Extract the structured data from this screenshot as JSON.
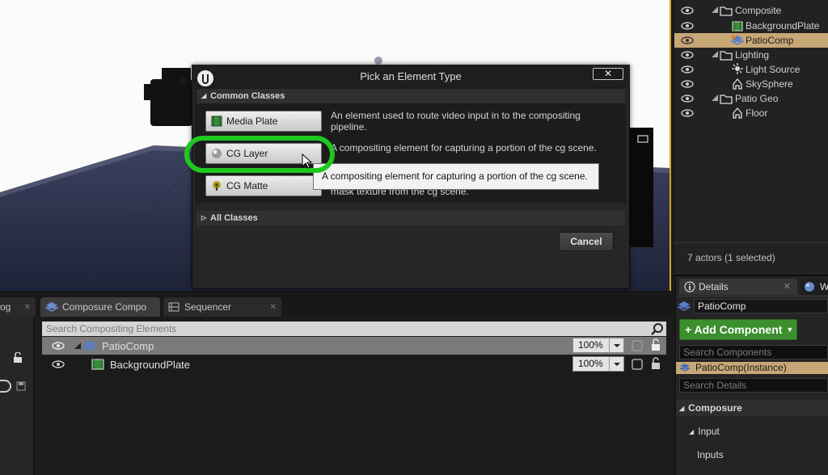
{
  "dialog": {
    "title": "Pick an Element Type",
    "close": "✕",
    "common_header": "Common Classes",
    "all_header": "All Classes",
    "cancel": "Cancel",
    "classes": [
      {
        "label": "Media Plate",
        "description": "An element used to route video input in to the compositing pipeline.",
        "icon": "media-plate-icon"
      },
      {
        "label": "CG Layer",
        "description": "A compositing element for capturing a portion of the cg scene.",
        "icon": "cg-layer-icon"
      },
      {
        "label": "CG Matte",
        "description": "mask texture from the cg scene.",
        "icon": "cg-matte-icon"
      }
    ],
    "tooltip": "A compositing element for capturing a portion of the cg scene."
  },
  "outliner": {
    "items": [
      {
        "label": "Composite",
        "icon": "folder-icon"
      },
      {
        "label": "BackgroundPlate",
        "icon": "media-plate-icon"
      },
      {
        "label": "PatioComp",
        "icon": "composite-icon",
        "selected": true
      },
      {
        "label": "Lighting",
        "icon": "folder-icon"
      },
      {
        "label": "Light Source",
        "icon": "light-icon"
      },
      {
        "label": "SkySphere",
        "icon": "actor-icon"
      },
      {
        "label": "Patio Geo",
        "icon": "folder-icon"
      },
      {
        "label": "Floor",
        "icon": "actor-icon"
      }
    ],
    "count": "7 actors (1 selected)"
  },
  "details": {
    "tab": "Details",
    "tab2": "W",
    "name": "PatioComp",
    "add_component": "+ Add Component",
    "search_components": "Search Components",
    "instance": "PatioComp(Instance)",
    "search_details": "Search Details",
    "categories": [
      "Composure",
      "Input",
      "Inputs"
    ]
  },
  "bottom": {
    "tabs": [
      "og",
      "Composure Compo",
      "Sequencer"
    ],
    "search_placeholder": "Search Compositing Elements",
    "rows": [
      {
        "label": "PatioComp",
        "percent": "100%"
      },
      {
        "label": "BackgroundPlate",
        "percent": "100%"
      }
    ]
  },
  "colors": {
    "selection": "#c8a776",
    "highlight": "#1ec81e",
    "add_button": "#3c8f2d"
  }
}
